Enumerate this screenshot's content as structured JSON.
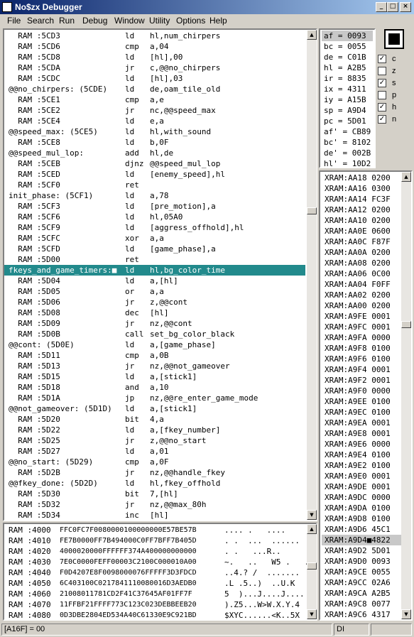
{
  "window": {
    "title": "No$zx Debugger",
    "controls": [
      "_",
      "□",
      "×"
    ]
  },
  "menu": [
    "File",
    "Search",
    "Run",
    "Debug",
    "Window",
    "Utility",
    "Options",
    "Help"
  ],
  "disassembly": [
    {
      "a": "  RAM :5CD3",
      "m": "ld",
      "o": "hl,num_chirpers"
    },
    {
      "a": "  RAM :5CD6",
      "m": "cmp",
      "o": "a,04"
    },
    {
      "a": "  RAM :5CD8",
      "m": "ld",
      "o": "[hl],00"
    },
    {
      "a": "  RAM :5CDA",
      "m": "jr",
      "o": "c,@@no_chirpers"
    },
    {
      "a": "  RAM :5CDC",
      "m": "ld",
      "o": "[hl],03"
    },
    {
      "a": "@@no_chirpers: (5CDE)",
      "m": "ld",
      "o": "de,oam_tile_old"
    },
    {
      "a": "  RAM :5CE1",
      "m": "cmp",
      "o": "a,e"
    },
    {
      "a": "  RAM :5CE2",
      "m": "jr",
      "o": "nc,@@speed_max"
    },
    {
      "a": "  RAM :5CE4",
      "m": "ld",
      "o": "e,a"
    },
    {
      "a": "@@speed_max: (5CE5)",
      "m": "ld",
      "o": "hl,with_sound"
    },
    {
      "a": "  RAM :5CE8",
      "m": "ld",
      "o": "b,0F"
    },
    {
      "a": "@@speed_mul_lop:",
      "m": "add",
      "o": "hl,de"
    },
    {
      "a": "  RAM :5CEB",
      "m": "djnz",
      "o": "@@speed_mul_lop"
    },
    {
      "a": "  RAM :5CED",
      "m": "ld",
      "o": "[enemy_speed],hl"
    },
    {
      "a": "  RAM :5CF0",
      "m": "ret",
      "o": ""
    },
    {
      "a": "init_phase: (5CF1)",
      "m": "ld",
      "o": "a,78"
    },
    {
      "a": "  RAM :5CF3",
      "m": "ld",
      "o": "[pre_motion],a"
    },
    {
      "a": "  RAM :5CF6",
      "m": "ld",
      "o": "hl,05A0"
    },
    {
      "a": "  RAM :5CF9",
      "m": "ld",
      "o": "[aggress_offhold],hl"
    },
    {
      "a": "  RAM :5CFC",
      "m": "xor",
      "o": "a,a"
    },
    {
      "a": "  RAM :5CFD",
      "m": "ld",
      "o": "[game_phase],a"
    },
    {
      "a": "  RAM :5D00",
      "m": "ret",
      "o": ""
    },
    {
      "a": "fkeys_and_game_timers:■",
      "m": "ld",
      "o": "hl,bg_color_time"
    },
    {
      "a": "  RAM :5D04",
      "m": "ld",
      "o": "a,[hl]"
    },
    {
      "a": "  RAM :5D05",
      "m": "or",
      "o": "a,a"
    },
    {
      "a": "  RAM :5D06",
      "m": "jr",
      "o": "z,@@cont"
    },
    {
      "a": "  RAM :5D08",
      "m": "dec",
      "o": "[hl]"
    },
    {
      "a": "  RAM :5D09",
      "m": "jr",
      "o": "nz,@@cont"
    },
    {
      "a": "  RAM :5D0B",
      "m": "call",
      "o": "set_bg_color_black"
    },
    {
      "a": "@@cont: (5D0E)",
      "m": "ld",
      "o": "a,[game_phase]"
    },
    {
      "a": "  RAM :5D11",
      "m": "cmp",
      "o": "a,0B"
    },
    {
      "a": "  RAM :5D13",
      "m": "jr",
      "o": "nz,@@not_gameover"
    },
    {
      "a": "  RAM :5D15",
      "m": "ld",
      "o": "a,[stick1]"
    },
    {
      "a": "  RAM :5D18",
      "m": "and",
      "o": "a,10"
    },
    {
      "a": "  RAM :5D1A",
      "m": "jp",
      "o": "nz,@@re_enter_game_mode"
    },
    {
      "a": "@@not_gameover: (5D1D)",
      "m": "ld",
      "o": "a,[stick1]"
    },
    {
      "a": "  RAM :5D20",
      "m": "bit",
      "o": "4,a"
    },
    {
      "a": "  RAM :5D22",
      "m": "ld",
      "o": "a,[fkey_number]"
    },
    {
      "a": "  RAM :5D25",
      "m": "jr",
      "o": "z,@@no_start"
    },
    {
      "a": "  RAM :5D27",
      "m": "ld",
      "o": "a,01"
    },
    {
      "a": "@@no_start: (5D29)",
      "m": "cmp",
      "o": "a,0F"
    },
    {
      "a": "  RAM :5D2B",
      "m": "jr",
      "o": "nz,@@handle_fkey"
    },
    {
      "a": "@@fkey_done: (5D2D)",
      "m": "ld",
      "o": "hl,fkey_offhold"
    },
    {
      "a": "  RAM :5D30",
      "m": "bit",
      "o": "7,[hl]"
    },
    {
      "a": "  RAM :5D32",
      "m": "jr",
      "o": "nz,@@max_80h"
    },
    {
      "a": "  RAM :5D34",
      "m": "inc",
      "o": "[hl]"
    }
  ],
  "highlight_row": 22,
  "registers": [
    "af = 0093",
    "bc = 0055",
    "de = C01B",
    "hl = A2B5",
    "ir = 8835",
    "ix = 4311",
    "iy = A15B",
    "sp = A9D4",
    "pc = 5D01",
    "af' = CB89",
    "bc' = 8102",
    "de' = 002B",
    "hl' = 10D2"
  ],
  "flags": [
    {
      "name": "c",
      "checked": true
    },
    {
      "name": "z",
      "checked": false
    },
    {
      "name": "s",
      "checked": true
    },
    {
      "name": "p",
      "checked": false
    },
    {
      "name": "h",
      "checked": true
    },
    {
      "name": "n",
      "checked": true
    }
  ],
  "stack": [
    "XRAM:AA18 0200",
    "XRAM:AA16 0300",
    "XRAM:AA14 FC3F",
    "XRAM:AA12 0200",
    "XRAM:AA10 0200",
    "XRAM:AA0E 0600",
    "XRAM:AA0C F87F",
    "XRAM:AA0A 0200",
    "XRAM:AA08 0200",
    "XRAM:AA06 0C00",
    "XRAM:AA04 F0FF",
    "XRAM:AA02 0200",
    "XRAM:AA00 0200",
    "XRAM:A9FE 0001",
    "XRAM:A9FC 0001",
    "XRAM:A9FA 0000",
    "XRAM:A9F8 0100",
    "XRAM:A9F6 0100",
    "XRAM:A9F4 0001",
    "XRAM:A9F2 0001",
    "XRAM:A9F0 0000",
    "XRAM:A9EE 0100",
    "XRAM:A9EC 0100",
    "XRAM:A9EA 0001",
    "XRAM:A9E8 0001",
    "XRAM:A9E6 0000",
    "XRAM:A9E4 0100",
    "XRAM:A9E2 0100",
    "XRAM:A9E0 0001",
    "XRAM:A9DE 0001",
    "XRAM:A9DC 0000",
    "XRAM:A9DA 0100",
    "XRAM:A9D8 0100",
    "XRAM:A9D6 45C1",
    "XRAM:A9D4■4822",
    "XRAM:A9D2 5D01",
    "XRAM:A9D0 0093",
    "XRAM:A9CE 0055",
    "XRAM:A9CC 02A6",
    "XRAM:A9CA A2B5",
    "XRAM:A9C8 0077",
    "XRAM:A9C6 4317"
  ],
  "stack_highlight_row": 34,
  "hexdump": [
    {
      "a": "RAM :4000",
      "h": "FFC0FC7F0080000100000000E57BE57B",
      "c": ".... .   ...."
    },
    {
      "a": "RAM :4010",
      "h": "FE7B0000FF7B494000C0FF7BFF7B405D",
      "c": ". .  ...  ......"
    },
    {
      "a": "RAM :4020",
      "h": "4000020000FFFFFF374A400000000000",
      "c": ". .   ...R.."
    },
    {
      "a": "RAM :4030",
      "h": "7E0C0000FEFF00003C2100C000010A00",
      "c": "~.   ..   W5 .   ."
    },
    {
      "a": "RAM :4040",
      "h": "F0D4207E8F0098000076FFFFF3D3FDCD",
      "c": "..4.? /  ......."
    },
    {
      "a": "RAM :4050",
      "h": "6C403100C0217841110080016D3AEDB0",
      "c": ".L .5..)  ..U.K"
    },
    {
      "a": "RAM :4060",
      "h": "21008011781CD2F41C37645AF01FF7F",
      "c": "5  )...J....J...."
    },
    {
      "a": "RAM :4070",
      "h": "11FFBF21FFFF773C123C023DEBBEEB20",
      "c": ").Z5...W>W.X.Y.4"
    },
    {
      "a": "RAM :4080",
      "h": "0D3DBE2804ED534A40C61330E9C921BD",
      "c": "$XYC......<K..5X"
    }
  ],
  "status": {
    "address": "[A16F] = 00",
    "mode": "DI"
  }
}
